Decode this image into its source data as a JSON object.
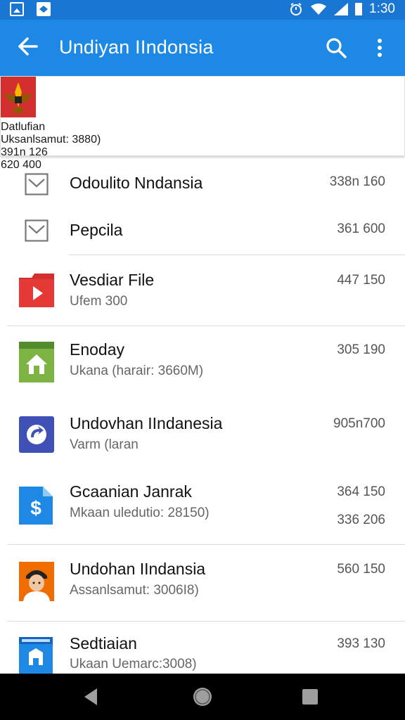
{
  "status_bar": {
    "time": "1:30"
  },
  "app_bar": {
    "title": "Undiyan IIndonsia",
    "icons": {
      "back": "arrow-back-icon",
      "search": "search-icon",
      "more": "more-vert-icon"
    }
  },
  "rows": [
    {
      "icon": "garuda-emblem-icon",
      "title": "Datlufian",
      "subtitle": "Uksanlsamut: 3880)",
      "value1": "391n 126",
      "value2": "620   400"
    },
    {
      "icon": "checkbox-icon",
      "title": "Odoulito Nndansia",
      "subtitle": "",
      "value1": "338n 160",
      "value2": ""
    },
    {
      "icon": "checkbox-icon",
      "title": "Pepcila",
      "subtitle": "",
      "value1": "361   600",
      "value2": ""
    },
    {
      "icon": "video-folder-icon",
      "title": "Vesdiar File",
      "subtitle": "Ufem 300",
      "value1": "447   150",
      "value2": ""
    },
    {
      "icon": "home-app-icon",
      "title": "Enoday",
      "subtitle": "Ukana (harair: 3660M)",
      "value1": "305   190",
      "value2": ""
    },
    {
      "icon": "refresh-app-icon",
      "title": "Undovhan IIndanesia",
      "subtitle": "Varm (laran",
      "value1": "905n700",
      "value2": ""
    },
    {
      "icon": "dollar-file-icon",
      "title": "Gcaanian Janrak",
      "subtitle": "Mkaan uledutio: 28150)",
      "value1": "364   150",
      "value2": "336   206"
    },
    {
      "icon": "person-avatar-icon",
      "title": "Undohan IIndansia",
      "subtitle": "Assanlsamut: 3006I8)",
      "value1": "560   150",
      "value2": ""
    },
    {
      "icon": "building-app-icon",
      "title": "Sedtiaian",
      "subtitle": "Ukaan Uemarc:3008)",
      "value1": "393   130",
      "value2": ""
    }
  ],
  "nav_bar": {
    "back": "nav-back-icon",
    "home": "nav-home-icon",
    "recents": "nav-recents-icon"
  },
  "colors": {
    "status_bar": "#1976d2",
    "app_bar": "#1e88e5",
    "nav_bar": "#000000"
  }
}
